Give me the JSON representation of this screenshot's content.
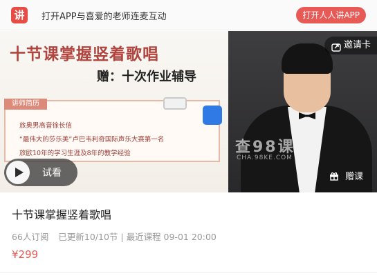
{
  "app_banner": {
    "logo_char": "讲",
    "title": "打开APP与喜爱的老师连麦互动",
    "open_button": "打开人人讲APP"
  },
  "hero": {
    "headline": "十节课掌握竖着歌唱",
    "gift_line": "赠：十次作业辅导",
    "bio_tag": "讲师简历",
    "bio_lines": [
      "旅奥男高音徐长信",
      "“最伟大的莎乐美”卢巴韦利奇国际声乐大赛第一名",
      "旅欧10年的学习生涯及8年的教学经验"
    ],
    "watermark": "查98课",
    "watermark_sub": "CHA.98KE.COM",
    "invite_label": "邀请卡",
    "trial_label": "试看",
    "gift_course_label": "赠课"
  },
  "course": {
    "title": "十节课掌握竖着歌唱",
    "subscribers": "66人订阅",
    "update_info": "已更新10/10节 | 最近课程 09-01 20:00",
    "price": "¥299"
  },
  "colors": {
    "accent": "#e85a55",
    "headline_red": "#b0443f",
    "bio_text": "#9b3d35"
  },
  "icons": {
    "logo": "app-logo",
    "invite": "share-icon",
    "trial": "play-icon",
    "gift": "gift-icon"
  }
}
